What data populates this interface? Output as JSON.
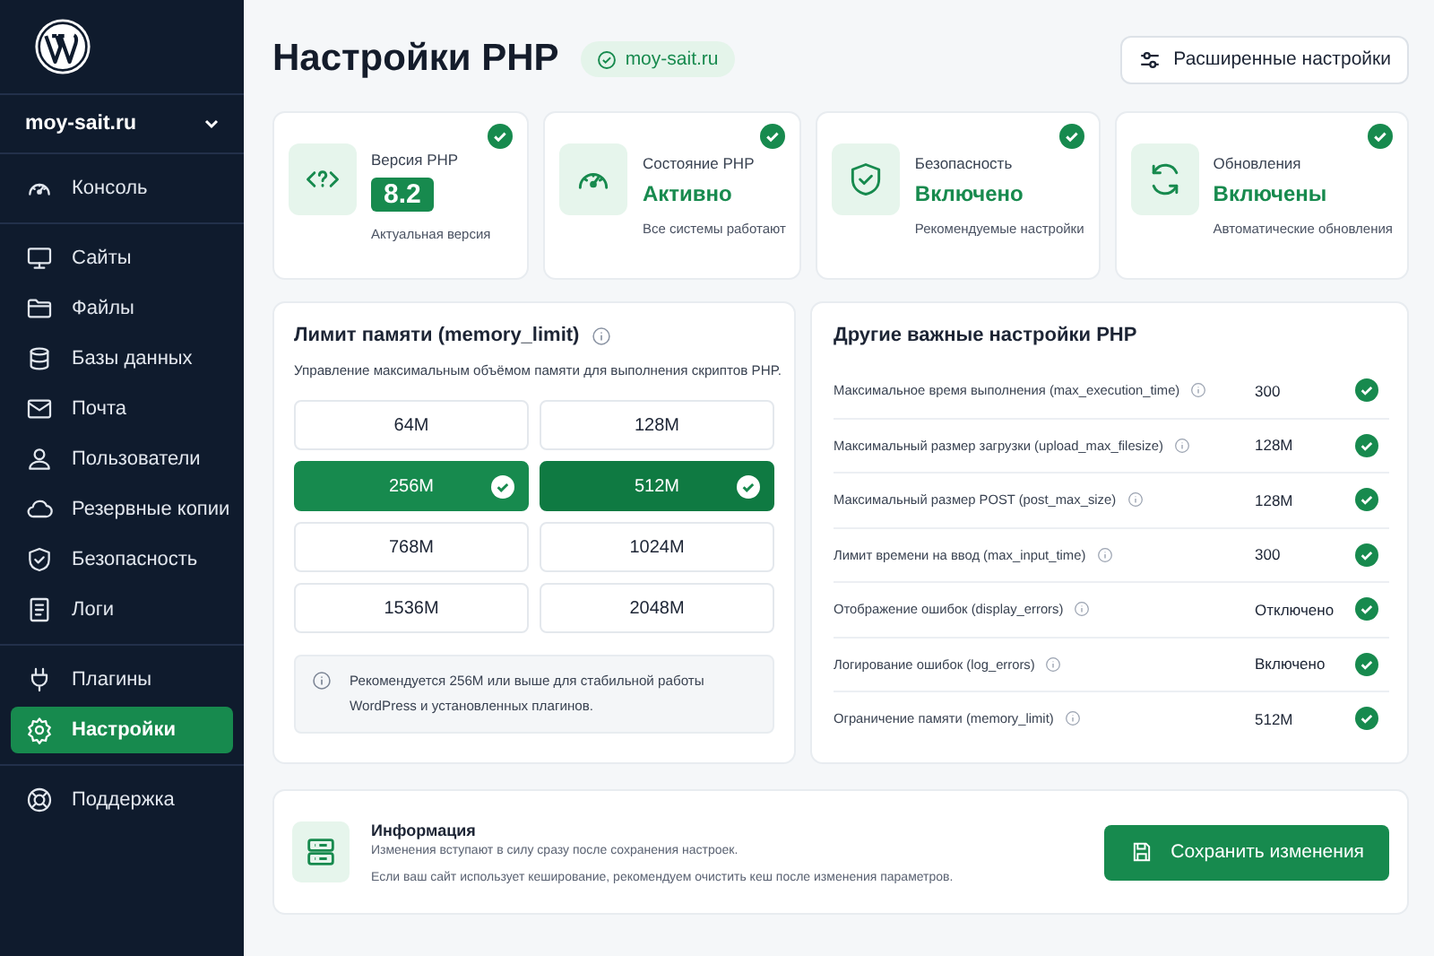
{
  "sidebar": {
    "site": "moy-sait.ru",
    "groups": [
      [
        {
          "label": "Консоль",
          "selected": false
        }
      ],
      [
        {
          "label": "Сайты",
          "selected": false
        },
        {
          "label": "Файлы",
          "selected": false
        },
        {
          "label": "Базы данных",
          "selected": false
        },
        {
          "label": "Почта",
          "selected": false
        },
        {
          "label": "Пользователи",
          "selected": false
        },
        {
          "label": "Резервные копии",
          "selected": false
        },
        {
          "label": "Безопасность",
          "selected": false
        },
        {
          "label": "Логи",
          "selected": false
        }
      ],
      [
        {
          "label": "Плагины",
          "selected": false
        },
        {
          "label": "Настройки",
          "selected": true
        }
      ],
      [
        {
          "label": "Поддержка",
          "selected": false
        }
      ]
    ]
  },
  "header": {
    "title": "Настройки PHP",
    "site_badge": "moy-sait.ru",
    "advanced_button": "Расширенные настройки"
  },
  "stat_cards": [
    {
      "label": "Версия PHP",
      "value": "8.2",
      "kind": "badge",
      "note": "Актуальная версия",
      "checked": true
    },
    {
      "label": "Состояние PHP",
      "value": "Активно",
      "kind": "text",
      "note": "Все системы работают",
      "checked": true
    },
    {
      "label": "Безопасность",
      "value": "Включено",
      "kind": "text",
      "note": "Рекомендуемые настройки",
      "checked": true
    },
    {
      "label": "Обновления",
      "value": "Включены",
      "kind": "text",
      "note": "Автоматические обновления",
      "checked": true
    }
  ],
  "memory": {
    "title": "Лимит памяти (memory_limit)",
    "description": "Управление максимальным объёмом памяти для выполнения скриптов PHP.",
    "options": [
      {
        "label": "64M",
        "selected": false
      },
      {
        "label": "128M",
        "selected": false
      },
      {
        "label": "256M",
        "selected": true
      },
      {
        "label": "512M",
        "selected": true
      },
      {
        "label": "768M",
        "selected": false
      },
      {
        "label": "1024M",
        "selected": false
      },
      {
        "label": "1536M",
        "selected": false
      },
      {
        "label": "2048M",
        "selected": false
      }
    ],
    "hint": "Рекомендуется 256M или выше для стабильной работы WordPress и установленных плагинов."
  },
  "other_settings": {
    "title": "Другие важные настройки PHP",
    "rows": [
      {
        "label": "Максимальное время выполнения (max_execution_time)",
        "value": "300",
        "ok": true
      },
      {
        "label": "Максимальный размер загрузки (upload_max_filesize)",
        "value": "128M",
        "ok": true
      },
      {
        "label": "Максимальный размер POST (post_max_size)",
        "value": "128M",
        "ok": true
      },
      {
        "label": "Лимит времени на ввод (max_input_time)",
        "value": "300",
        "ok": true
      },
      {
        "label": "Отображение ошибок (display_errors)",
        "value": "Отключено",
        "ok": true
      },
      {
        "label": "Логирование ошибок (log_errors)",
        "value": "Включено",
        "ok": true
      },
      {
        "label": "Ограничение памяти (memory_limit)",
        "value": "512M",
        "ok": true
      }
    ]
  },
  "info": {
    "title": "Информация",
    "lines": [
      "Изменения вступают в силу сразу после сохранения настроек.",
      "Если ваш сайт использует кеширование, рекомендуем очистить кеш после изменения параметров."
    ],
    "save_button": "Сохранить изменения"
  }
}
